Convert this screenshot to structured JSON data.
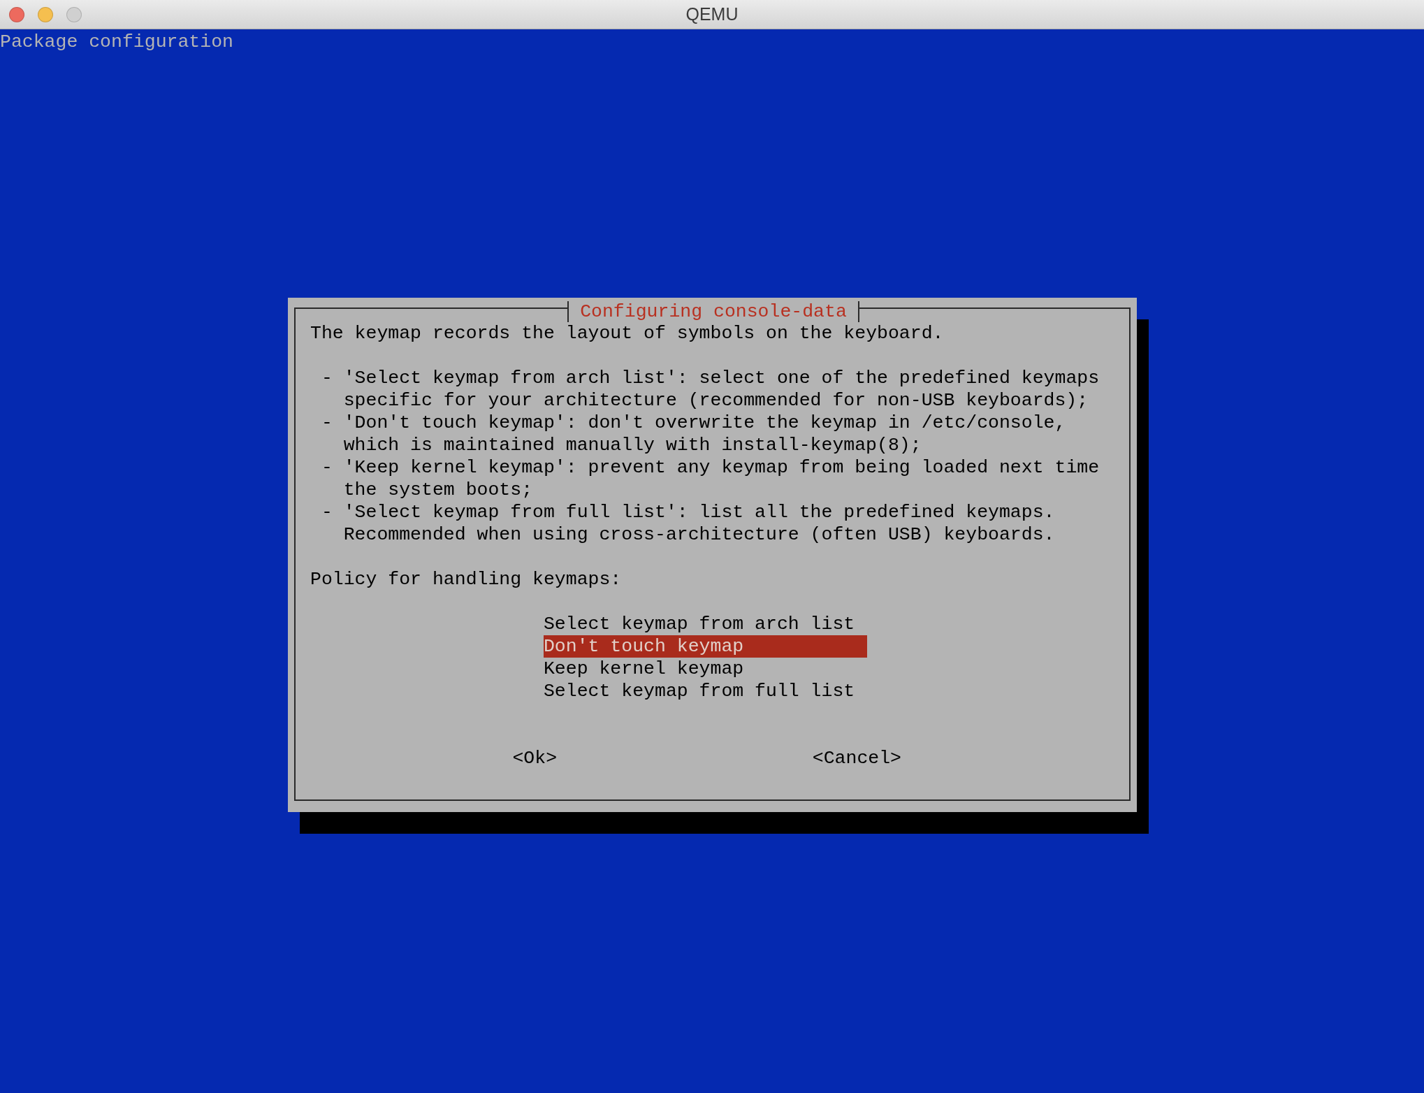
{
  "window": {
    "title": "QEMU"
  },
  "backtitle": "Package configuration",
  "dialog": {
    "title": "Configuring console-data",
    "intro": "The keymap records the layout of symbols on the keyboard.",
    "options_help": [
      "- 'Select keymap from arch list': select one of the predefined keymaps\nspecific for your architecture (recommended for non-USB keyboards);",
      "- 'Don't touch keymap': don't overwrite the keymap in /etc/console,\nwhich is maintained manually with install-keymap(8);",
      "- 'Keep kernel keymap': prevent any keymap from being loaded next time\nthe system boots;",
      "- 'Select keymap from full list': list all the predefined keymaps.\nRecommended when using cross-architecture (often USB) keyboards."
    ],
    "prompt": "Policy for handling keymaps:",
    "menu_items": [
      {
        "label": "Select keymap from arch list",
        "selected": false
      },
      {
        "label": "Don't touch keymap",
        "selected": true
      },
      {
        "label": "Keep kernel keymap",
        "selected": false
      },
      {
        "label": "Select keymap from full list",
        "selected": false
      }
    ],
    "buttons": [
      "<Ok>",
      "<Cancel>"
    ]
  }
}
